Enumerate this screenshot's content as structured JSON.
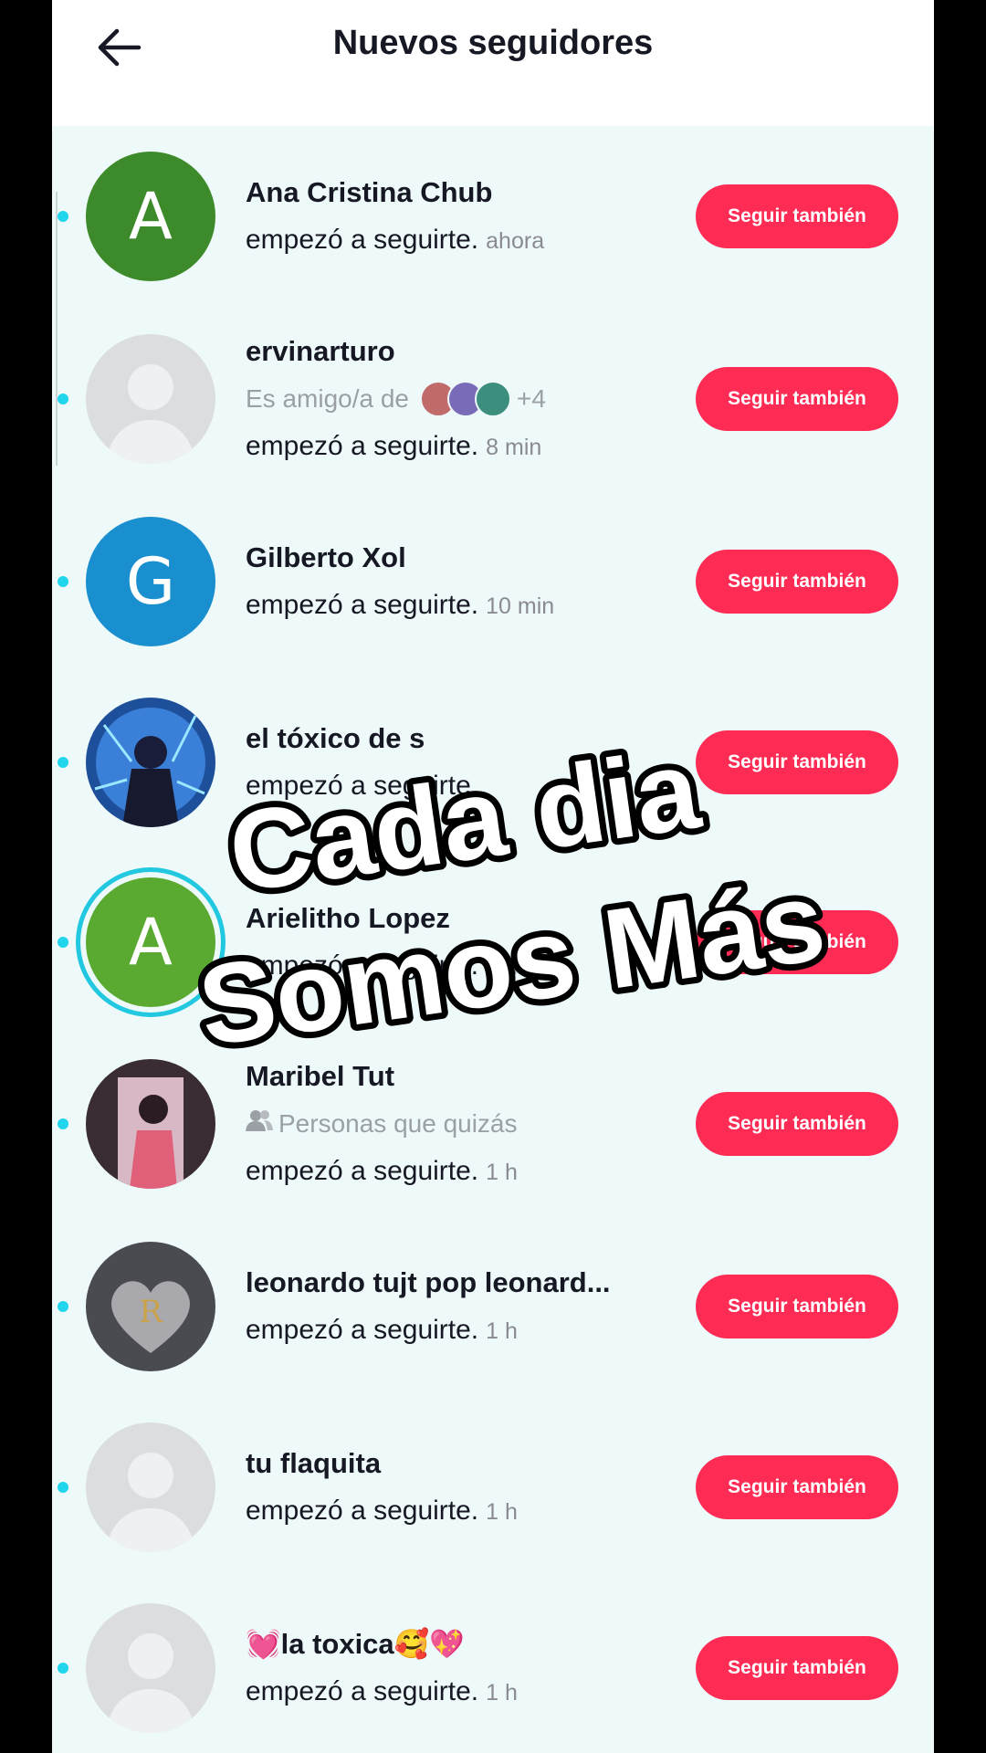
{
  "header": {
    "title": "Nuevos seguidores",
    "back_icon": "arrow-left-icon"
  },
  "colors": {
    "accent": "#fe2c55",
    "unread_dot": "#20d5ec",
    "background": "#eef9fa"
  },
  "follow_button_label": "Seguir también",
  "followers": [
    {
      "name": "Ana Cristina Chub",
      "action": "empezó a seguirte.",
      "time": "ahora",
      "avatar_type": "letter",
      "avatar_letter": "A",
      "avatar_color": "#3c8a2a"
    },
    {
      "name": "ervinarturo",
      "sub": "Es amigo/a de",
      "sub_extra": "+4",
      "action": "empezó a seguirte.",
      "time": "8 min",
      "avatar_type": "default"
    },
    {
      "name": "Gilberto Xol",
      "action": "empezó a seguirte.",
      "time": "10 min",
      "avatar_type": "letter",
      "avatar_letter": "G",
      "avatar_color": "#1a8fd0"
    },
    {
      "name": "el tóxico de s",
      "action": "empezó a seguirte.",
      "time": "",
      "avatar_type": "photo-blue"
    },
    {
      "name": "Arielitho Lopez",
      "action": "empezó a seguirte.",
      "time": "1 h",
      "avatar_type": "letter",
      "avatar_letter": "A",
      "avatar_color": "#5aaa32"
    },
    {
      "name": "Maribel Tut",
      "sub": "Personas que quizás",
      "action": "empezó a seguirte.",
      "time": "1 h",
      "avatar_type": "photo-pink"
    },
    {
      "name": "leonardo tujt pop leonard...",
      "action": "empezó a seguirte.",
      "time": "1 h",
      "avatar_type": "photo-heart"
    },
    {
      "name": "tu flaquita",
      "action": "empezó a seguirte.",
      "time": "1 h",
      "avatar_type": "default"
    },
    {
      "name": "💓la toxica🥰💖",
      "action": "empezó a seguirte.",
      "time": "1 h",
      "avatar_type": "default"
    }
  ],
  "overlay": {
    "line1": "Cada dia",
    "line2": "Somos Más"
  }
}
